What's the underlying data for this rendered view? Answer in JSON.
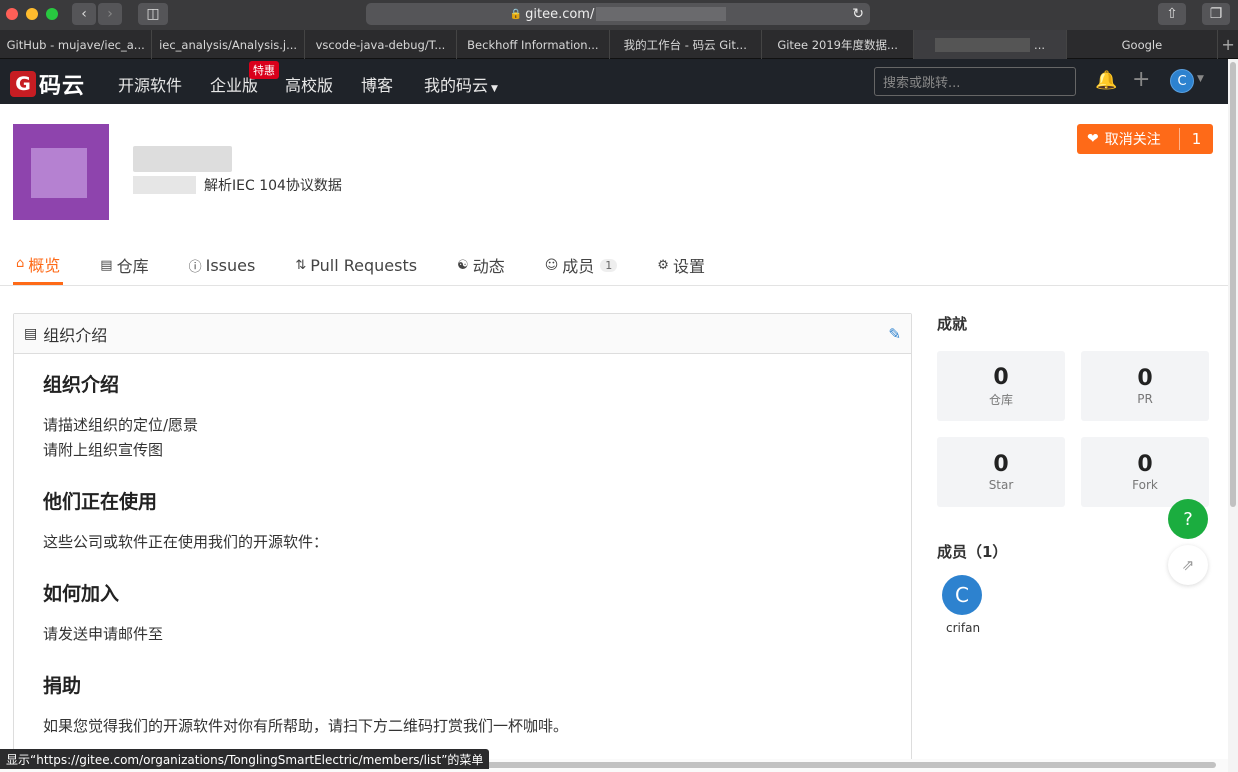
{
  "browser": {
    "url": "gitee.com/",
    "tabs": [
      {
        "label": "GitHub - mujave/iec_a..."
      },
      {
        "label": "iec_analysis/Analysis.j..."
      },
      {
        "label": "vscode-java-debug/T..."
      },
      {
        "label": "Beckhoff Information..."
      },
      {
        "label": "我的工作台 - 码云 Git..."
      },
      {
        "label": "Gitee 2019年度数据..."
      },
      {
        "label": "..."
      },
      {
        "label": "Google"
      }
    ],
    "new_tab": "+",
    "status_bar": "显示“https://gitee.com/organizations/TonglingSmartElectric/members/list”的菜单"
  },
  "nav": {
    "logo_text": "码云",
    "logo_letter": "G",
    "links": [
      "开源软件",
      "企业版",
      "高校版",
      "博客",
      "我的码云"
    ],
    "hot_badge": "特惠",
    "search_placeholder": "搜索或跳转...",
    "avatar_letter": "C"
  },
  "org": {
    "description": "解析IEC 104协议数据",
    "follow_label": "取消关注",
    "follow_count": "1"
  },
  "tabs": [
    {
      "label": "概览",
      "icon": "home-icon"
    },
    {
      "label": "仓库",
      "icon": "repo-icon"
    },
    {
      "label": "Issues",
      "icon": "issue-icon"
    },
    {
      "label": "Pull Requests",
      "icon": "pr-icon"
    },
    {
      "label": "动态",
      "icon": "activity-icon"
    },
    {
      "label": "成员",
      "icon": "members-icon",
      "badge": "1"
    },
    {
      "label": "设置",
      "icon": "settings-icon"
    }
  ],
  "intro": {
    "header": "组织介绍",
    "sections": [
      {
        "title": "组织介绍",
        "lines": [
          "请描述组织的定位/愿景",
          "请附上组织宣传图"
        ]
      },
      {
        "title": "他们正在使用",
        "lines": [
          "这些公司或软件正在使用我们的开源软件："
        ]
      },
      {
        "title": "如何加入",
        "lines": [
          "请发送申请邮件至"
        ]
      },
      {
        "title": "捐助",
        "lines": [
          "如果您觉得我们的开源软件对你有所帮助，请扫下方二维码打赏我们一杯咖啡。"
        ]
      }
    ]
  },
  "achievements": {
    "title": "成就",
    "stats": [
      {
        "value": "0",
        "label": "仓库"
      },
      {
        "value": "0",
        "label": "PR"
      },
      {
        "value": "0",
        "label": "Star"
      },
      {
        "value": "0",
        "label": "Fork"
      }
    ]
  },
  "members": {
    "title": "成员（1）",
    "list": [
      {
        "letter": "C",
        "name": "crifan"
      }
    ]
  },
  "colors": {
    "brand": "#c71d23",
    "accent": "#fe6a18",
    "help": "#1bad3f",
    "avatar": "#2d82cf"
  }
}
